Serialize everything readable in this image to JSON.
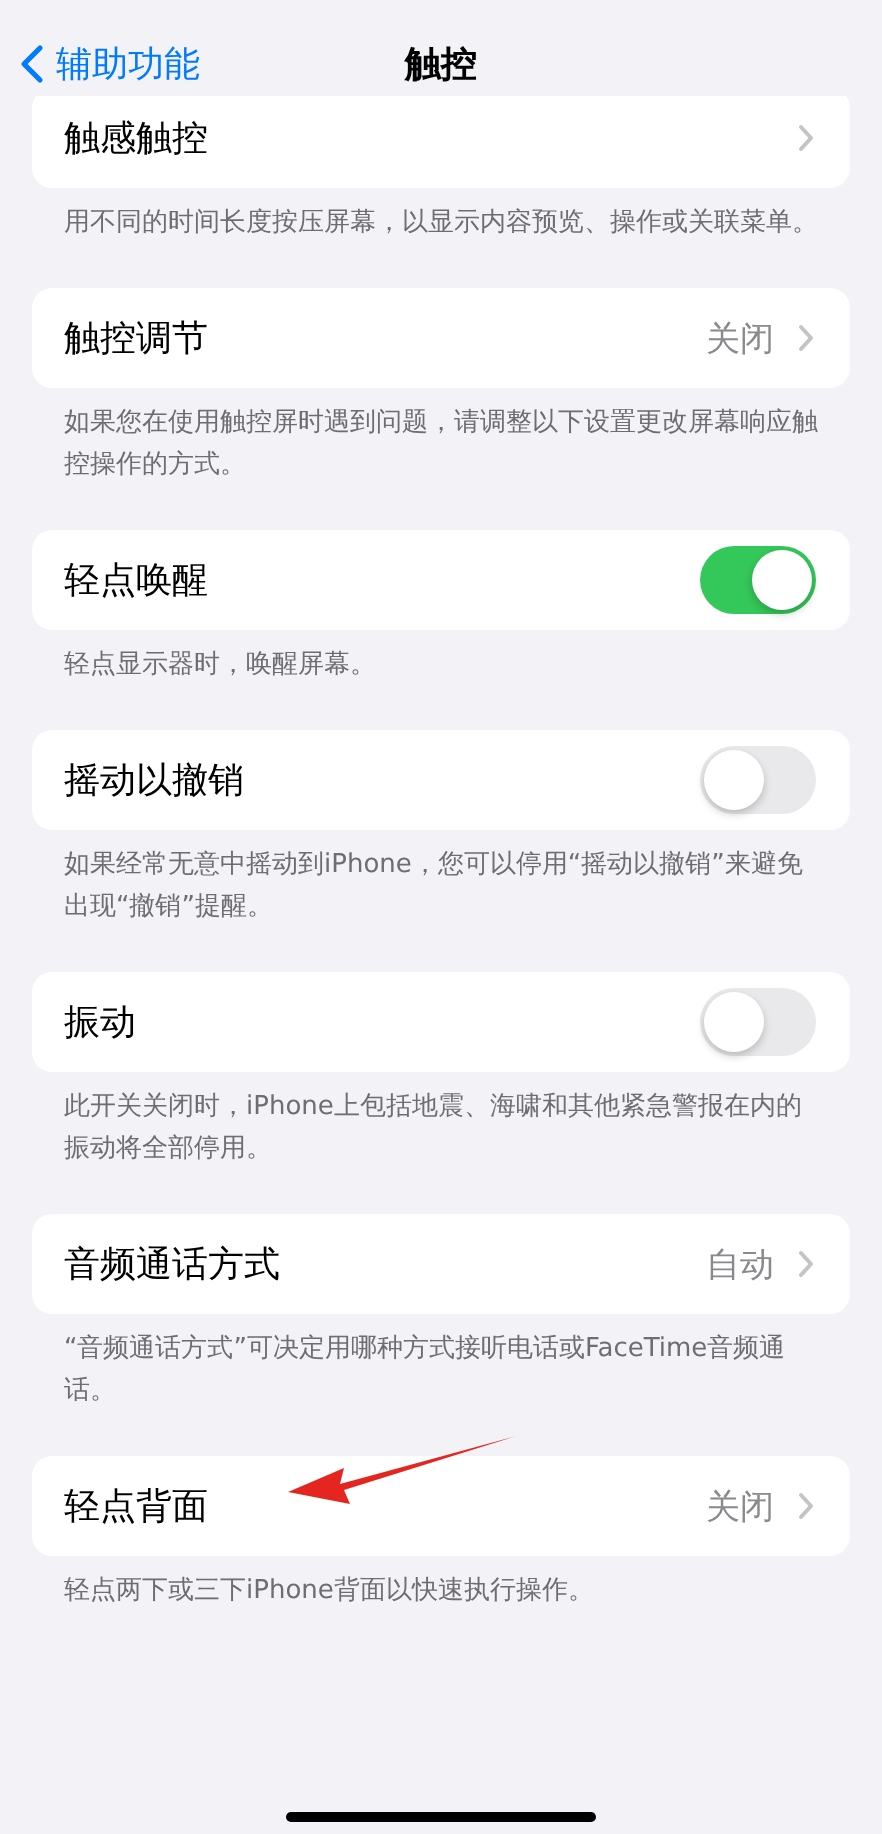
{
  "nav": {
    "back": "辅助功能",
    "title": "触控"
  },
  "sections": [
    {
      "kind": "link",
      "label": "触感触控",
      "footer": "用不同的时间长度按压屏幕，以显示内容预览、操作或关联菜单。"
    },
    {
      "kind": "link",
      "label": "触控调节",
      "value": "关闭",
      "footer": "如果您在使用触控屏时遇到问题，请调整以下设置更改屏幕响应触控操作的方式。"
    },
    {
      "kind": "toggle",
      "label": "轻点唤醒",
      "on": true,
      "footer": "轻点显示器时，唤醒屏幕。"
    },
    {
      "kind": "toggle",
      "label": "摇动以撤销",
      "on": false,
      "footer": "如果经常无意中摇动到iPhone，您可以停用“摇动以撤销”来避免出现“撤销”提醒。"
    },
    {
      "kind": "toggle",
      "label": "振动",
      "on": false,
      "footer": "此开关关闭时，iPhone上包括地震、海啸和其他紧急警报在内的振动将全部停用。"
    },
    {
      "kind": "link",
      "label": "音频通话方式",
      "value": "自动",
      "footer": "“音频通话方式”可决定用哪种方式接听电话或FaceTime音频通话。"
    },
    {
      "kind": "link",
      "label": "轻点背面",
      "value": "关闭",
      "footer": "轻点两下或三下iPhone背面以快速执行操作。"
    }
  ]
}
